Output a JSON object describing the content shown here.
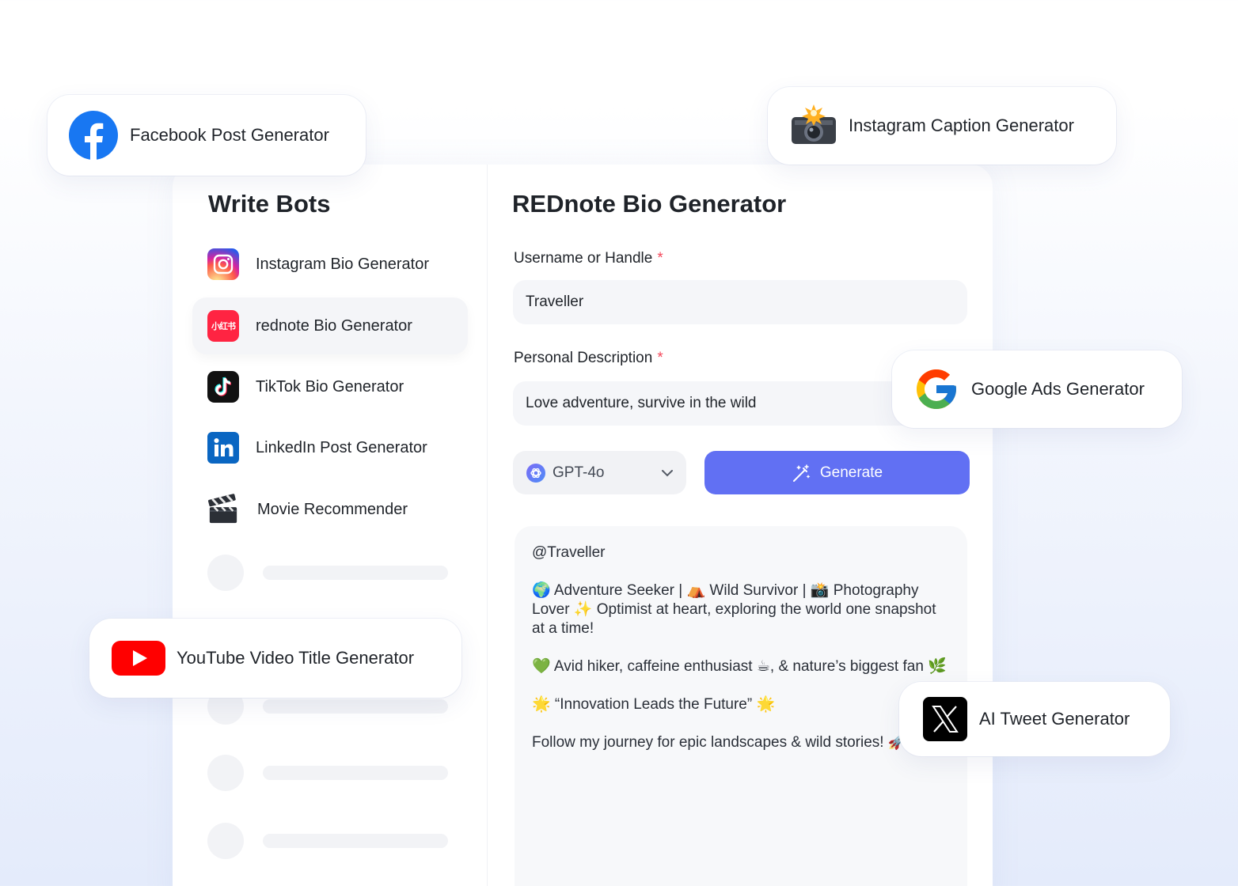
{
  "sidebar": {
    "title": "Write Bots",
    "items": [
      {
        "label": "Instagram Bio Generator",
        "icon": "instagram-icon",
        "active": false
      },
      {
        "label": "rednote Bio Generator",
        "icon": "rednote-icon",
        "active": true
      },
      {
        "label": "TikTok Bio Generator",
        "icon": "tiktok-icon",
        "active": false
      },
      {
        "label": "LinkedIn Post Generator",
        "icon": "linkedin-icon",
        "active": false
      },
      {
        "label": "Movie Recommender",
        "icon": "clapperboard-icon",
        "active": false
      }
    ],
    "rednote_icon_text": "小红书"
  },
  "main": {
    "title": "REDnote Bio Generator",
    "username_label": "Username or Handle",
    "username_value": "Traveller",
    "description_label": "Personal Description",
    "description_value": "Love adventure, survive in the wild",
    "required_mark": "*",
    "model": "GPT-4o",
    "generate_label": "Generate"
  },
  "output": {
    "line1": "@Traveller",
    "line2": "🌍 Adventure Seeker | ⛺ Wild Survivor | 📸 Photography Lover ✨ Optimist at heart, exploring the world one snapshot at a time!",
    "line3": "💚 Avid hiker, caffeine enthusiast ☕, & nature’s biggest fan 🌿",
    "line4": "🌟 “Innovation Leads the Future” 🌟",
    "line5": "Follow my journey for epic landscapes & wild stories! 🚀✨"
  },
  "floating": {
    "facebook": "Facebook Post Generator",
    "instagram_caption": "Instagram Caption Generator",
    "google_ads": "Google Ads Generator",
    "youtube": "YouTube Video Title Generator",
    "tweet": "AI Tweet Generator"
  },
  "colors": {
    "accent": "#6170f3",
    "required": "#f5475a",
    "facebook": "#1877f2",
    "youtube": "#ff0000",
    "rednote": "#ff2442",
    "linkedin": "#0a66c2"
  }
}
